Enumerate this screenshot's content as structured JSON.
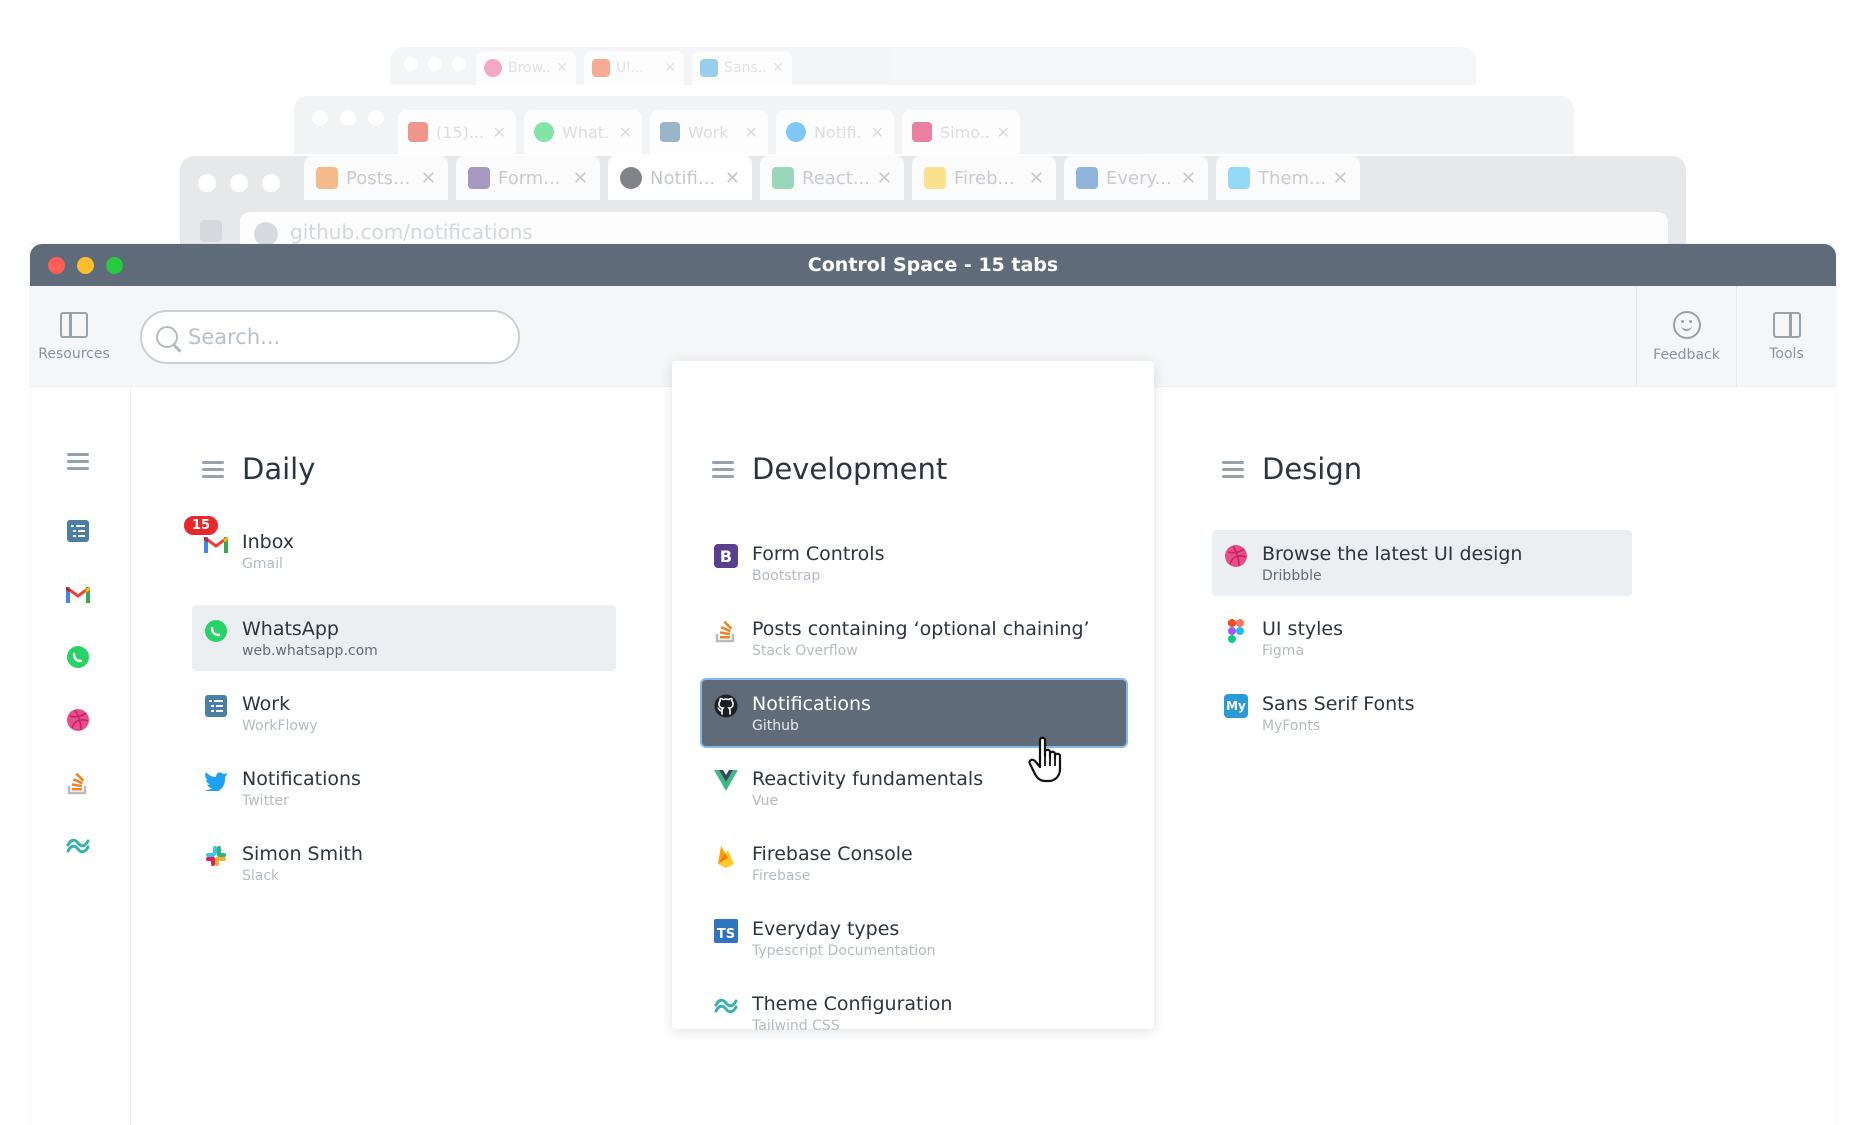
{
  "window": {
    "title": "Control Space - 15 tabs"
  },
  "background_windows": {
    "back": {
      "tabs": [
        {
          "label": "Brow...",
          "icon": "dribbble-icon",
          "color": "#ea4c89"
        },
        {
          "label": "UI...",
          "icon": "figma-icon",
          "color": "#f24e1e"
        },
        {
          "label": "Sans...",
          "icon": "myfonts-icon",
          "color": "#2b9bd8"
        }
      ]
    },
    "middle": {
      "tabs": [
        {
          "label": "(15)...",
          "icon": "gmail-icon",
          "color": "#ea4335"
        },
        {
          "label": "What...",
          "icon": "whatsapp-icon",
          "color": "#25d366"
        },
        {
          "label": "Work",
          "icon": "workflowy-icon",
          "color": "#4b7ea3"
        },
        {
          "label": "Notifi...",
          "icon": "twitter-icon",
          "color": "#1da1f2"
        },
        {
          "label": "Simo...",
          "icon": "slack-icon",
          "color": "#e01e5a"
        }
      ]
    },
    "front": {
      "tabs": [
        {
          "label": "Posts...",
          "icon": "stackoverflow-icon",
          "color": "#f48024"
        },
        {
          "label": "Form...",
          "icon": "bootstrap-icon",
          "color": "#5b3f8f"
        },
        {
          "label": "Notifi...",
          "icon": "github-icon",
          "color": "#1b1f23"
        },
        {
          "label": "React...",
          "icon": "vue-icon",
          "color": "#41b883"
        },
        {
          "label": "Fireb...",
          "icon": "firebase-icon",
          "color": "#ffca28"
        },
        {
          "label": "Every...",
          "icon": "typescript-icon",
          "color": "#2f74c0"
        },
        {
          "label": "Them...",
          "icon": "tailwind-icon",
          "color": "#38bdf8"
        }
      ],
      "address": "github.com/notifications"
    }
  },
  "toolbar": {
    "resources_label": "Resources",
    "search_placeholder": "Search...",
    "feedback_label": "Feedback",
    "tools_label": "Tools"
  },
  "rail": {
    "items": [
      "menu-icon",
      "workflowy-icon",
      "gmail-icon",
      "whatsapp-icon",
      "dribbble-icon",
      "stackoverflow-icon",
      "tailwind-icon"
    ]
  },
  "columns": {
    "daily": {
      "title": "Daily",
      "items": [
        {
          "name": "Inbox",
          "source": "Gmail",
          "icon": "gmail-icon",
          "badge": "15"
        },
        {
          "name": "WhatsApp",
          "source": "web.whatsapp.com",
          "icon": "whatsapp-icon",
          "state": "highlighted"
        },
        {
          "name": "Work",
          "source": "WorkFlowy",
          "icon": "workflowy-icon"
        },
        {
          "name": "Notifications",
          "source": "Twitter",
          "icon": "twitter-icon"
        },
        {
          "name": "Simon Smith",
          "source": "Slack",
          "icon": "slack-icon"
        }
      ]
    },
    "development": {
      "title": "Development",
      "items": [
        {
          "name": "Form Controls",
          "source": "Bootstrap",
          "icon": "bootstrap-icon",
          "glyph": "B"
        },
        {
          "name": "Posts containing ‘optional chaining’",
          "source": "Stack Overflow",
          "icon": "stackoverflow-icon"
        },
        {
          "name": "Notifications",
          "source": "Github",
          "icon": "github-icon",
          "state": "selected"
        },
        {
          "name": "Reactivity fundamentals",
          "source": "Vue",
          "icon": "vue-icon"
        },
        {
          "name": "Firebase Console",
          "source": "Firebase",
          "icon": "firebase-icon"
        },
        {
          "name": "Everyday types",
          "source": "Typescript Documentation",
          "icon": "typescript-icon",
          "glyph": "TS"
        },
        {
          "name": "Theme Configuration",
          "source": "Tailwind CSS",
          "icon": "tailwind-icon"
        }
      ]
    },
    "design": {
      "title": "Design",
      "items": [
        {
          "name": "Browse the latest UI design",
          "source": "Dribbble",
          "icon": "dribbble-icon",
          "state": "highlighted"
        },
        {
          "name": "UI styles",
          "source": "Figma",
          "icon": "figma-icon"
        },
        {
          "name": "Sans Serif Fonts",
          "source": "MyFonts",
          "icon": "myfonts-icon",
          "glyph": "My"
        }
      ]
    }
  },
  "colors": {
    "titlebar": "#5f6b78",
    "selected_item": "#5f6b78",
    "selected_outline": "#85b9ea",
    "highlight_item": "#eceff2",
    "badge": "#e8262b",
    "traffic_red": "#ff5f57",
    "traffic_yellow": "#febc2e",
    "traffic_green": "#28c840"
  }
}
